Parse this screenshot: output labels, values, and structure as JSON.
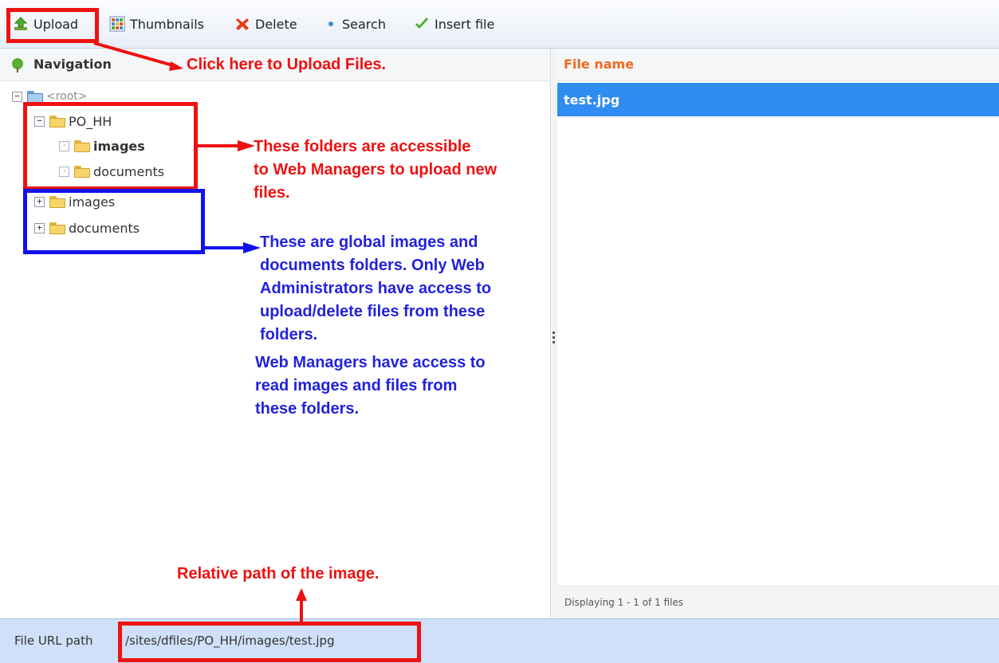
{
  "toolbar": {
    "upload": "Upload",
    "thumbnails": "Thumbnails",
    "delete": "Delete",
    "search": "Search",
    "insert_file": "Insert file"
  },
  "navigation": {
    "title": "Navigation",
    "tree": {
      "root": "<root>",
      "po_hh": "PO_HH",
      "po_hh_images": "images",
      "po_hh_documents": "documents",
      "images": "images",
      "documents": "documents"
    }
  },
  "file_list": {
    "header": "File name",
    "files": [
      "test.jpg"
    ],
    "footer": "Displaying 1 - 1 of 1 files"
  },
  "statusbar": {
    "label": "File URL path",
    "path": "/sites/dfiles/PO_HH/images/test.jpg"
  },
  "annotations": {
    "upload_note": "Click here to Upload Files.",
    "accessible_note": [
      "These folders are accessible",
      "to Web Managers to upload new",
      "files."
    ],
    "global_note": [
      "These are global images and",
      "documents folders. Only Web",
      "Administrators have access to",
      "upload/delete files from these",
      "folders."
    ],
    "read_note": [
      "Web Managers have access to",
      "read images and files from",
      "these folders."
    ],
    "path_note": "Relative path of the image."
  },
  "colors": {
    "annotation_red": "#ee1111",
    "annotation_blue": "#1111ee",
    "selection": "#2f8cf0",
    "header_accent": "#f26a22"
  }
}
